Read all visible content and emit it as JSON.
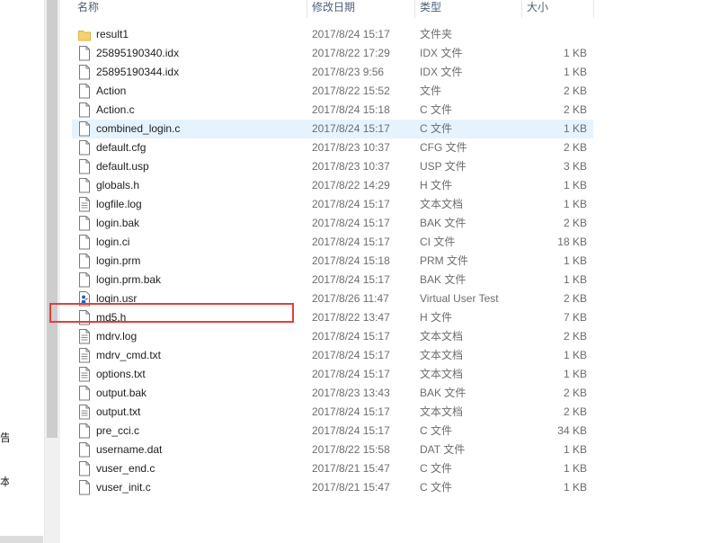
{
  "nav_fragments": [
    "告",
    "本"
  ],
  "columns": {
    "name": "名称",
    "date": "修改日期",
    "type": "类型",
    "size": "大小"
  },
  "files": [
    {
      "name": "result1",
      "date": "2017/8/24 15:17",
      "type": "文件夹",
      "size": "",
      "icon": "folder-icon"
    },
    {
      "name": "25895190340.idx",
      "date": "2017/8/22 17:29",
      "type": "IDX 文件",
      "size": "1 KB",
      "icon": "file-icon"
    },
    {
      "name": "25895190344.idx",
      "date": "2017/8/23 9:56",
      "type": "IDX 文件",
      "size": "1 KB",
      "icon": "file-icon"
    },
    {
      "name": "Action",
      "date": "2017/8/22 15:52",
      "type": "文件",
      "size": "2 KB",
      "icon": "file-icon"
    },
    {
      "name": "Action.c",
      "date": "2017/8/24 15:18",
      "type": "C 文件",
      "size": "2 KB",
      "icon": "file-icon"
    },
    {
      "name": "combined_login.c",
      "date": "2017/8/24 15:17",
      "type": "C 文件",
      "size": "1 KB",
      "icon": "file-icon"
    },
    {
      "name": "default.cfg",
      "date": "2017/8/23 10:37",
      "type": "CFG 文件",
      "size": "2 KB",
      "icon": "file-icon"
    },
    {
      "name": "default.usp",
      "date": "2017/8/23 10:37",
      "type": "USP 文件",
      "size": "3 KB",
      "icon": "file-icon"
    },
    {
      "name": "globals.h",
      "date": "2017/8/22 14:29",
      "type": "H 文件",
      "size": "1 KB",
      "icon": "file-icon"
    },
    {
      "name": "logfile.log",
      "date": "2017/8/24 15:17",
      "type": "文本文档",
      "size": "1 KB",
      "icon": "text-file-icon"
    },
    {
      "name": "login.bak",
      "date": "2017/8/24 15:17",
      "type": "BAK 文件",
      "size": "2 KB",
      "icon": "file-icon"
    },
    {
      "name": "login.ci",
      "date": "2017/8/24 15:17",
      "type": "CI 文件",
      "size": "18 KB",
      "icon": "file-icon"
    },
    {
      "name": "login.prm",
      "date": "2017/8/24 15:18",
      "type": "PRM 文件",
      "size": "1 KB",
      "icon": "file-icon"
    },
    {
      "name": "login.prm.bak",
      "date": "2017/8/24 15:17",
      "type": "BAK 文件",
      "size": "1 KB",
      "icon": "file-icon"
    },
    {
      "name": "login.usr",
      "date": "2017/8/26 11:47",
      "type": "Virtual User Test",
      "size": "2 KB",
      "icon": "vuser-file-icon"
    },
    {
      "name": "md5.h",
      "date": "2017/8/22 13:47",
      "type": "H 文件",
      "size": "7 KB",
      "icon": "file-icon"
    },
    {
      "name": "mdrv.log",
      "date": "2017/8/24 15:17",
      "type": "文本文档",
      "size": "2 KB",
      "icon": "text-file-icon"
    },
    {
      "name": "mdrv_cmd.txt",
      "date": "2017/8/24 15:17",
      "type": "文本文档",
      "size": "1 KB",
      "icon": "text-file-icon"
    },
    {
      "name": "options.txt",
      "date": "2017/8/24 15:17",
      "type": "文本文档",
      "size": "1 KB",
      "icon": "text-file-icon"
    },
    {
      "name": "output.bak",
      "date": "2017/8/23 13:43",
      "type": "BAK 文件",
      "size": "2 KB",
      "icon": "file-icon"
    },
    {
      "name": "output.txt",
      "date": "2017/8/24 15:17",
      "type": "文本文档",
      "size": "2 KB",
      "icon": "text-file-icon"
    },
    {
      "name": "pre_cci.c",
      "date": "2017/8/24 15:17",
      "type": "C 文件",
      "size": "34 KB",
      "icon": "file-icon"
    },
    {
      "name": "username.dat",
      "date": "2017/8/22 15:58",
      "type": "DAT 文件",
      "size": "1 KB",
      "icon": "file-icon"
    },
    {
      "name": "vuser_end.c",
      "date": "2017/8/21 15:47",
      "type": "C 文件",
      "size": "1 KB",
      "icon": "file-icon"
    },
    {
      "name": "vuser_init.c",
      "date": "2017/8/21 15:47",
      "type": "C 文件",
      "size": "1 KB",
      "icon": "file-icon"
    }
  ],
  "selected_file": "combined_login.c",
  "highlighted_file": "md5.h",
  "colors": {
    "selection": "#e5f3ff",
    "highlight_border": "#e0403c",
    "header_text": "#4c607a",
    "folder": "#f6d26b"
  }
}
